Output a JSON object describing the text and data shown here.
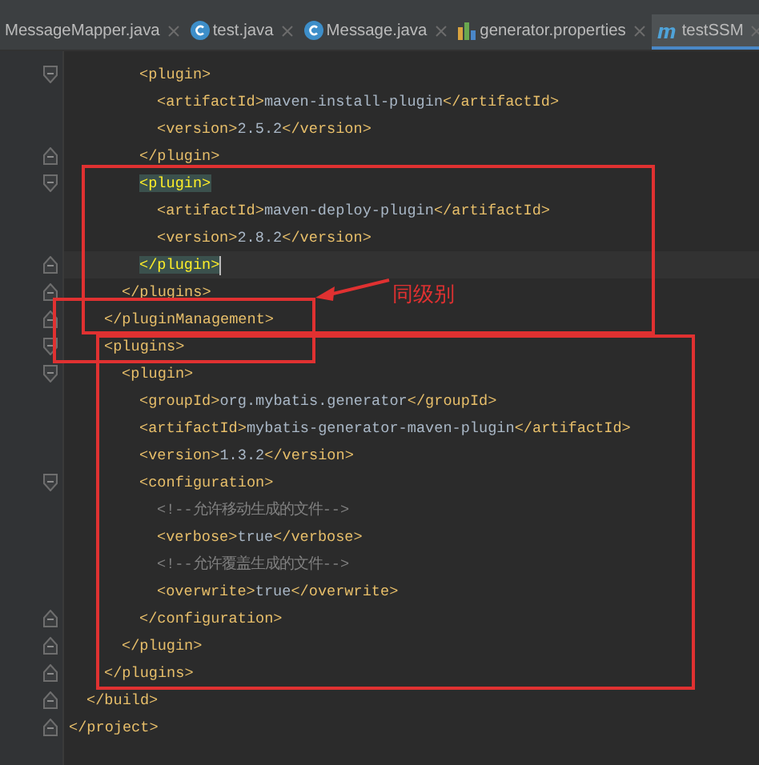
{
  "tabs": [
    {
      "label": "MessageMapper.java",
      "kind": "plain",
      "selected": false
    },
    {
      "label": "test.java",
      "kind": "class",
      "selected": false
    },
    {
      "label": "Message.java",
      "kind": "class",
      "selected": false
    },
    {
      "label": "generator.properties",
      "kind": "properties",
      "selected": false
    },
    {
      "label": "testSSM",
      "kind": "maven",
      "selected": true
    }
  ],
  "lines": [
    {
      "kind": "opener",
      "tokens": [
        {
          "kind": "tag",
          "text": "<plugin>"
        }
      ]
    },
    {
      "kind": "plain",
      "tokens": [
        {
          "kind": "tag",
          "text": "<artifactId>"
        },
        {
          "kind": "text",
          "text": "maven-install-plugin"
        },
        {
          "kind": "tag",
          "text": "</artifactId>"
        }
      ]
    },
    {
      "kind": "plain",
      "tokens": [
        {
          "kind": "tag",
          "text": "<version>"
        },
        {
          "kind": "text",
          "text": "2.5.2"
        },
        {
          "kind": "tag",
          "text": "</version>"
        }
      ]
    },
    {
      "kind": "closer",
      "tokens": [
        {
          "kind": "tag",
          "text": "</plugin>"
        }
      ]
    },
    {
      "kind": "opener",
      "tag_highlight": true,
      "tokens": [
        {
          "kind": "tag",
          "text": "<plugin>"
        }
      ]
    },
    {
      "kind": "plain",
      "tokens": [
        {
          "kind": "tag",
          "text": "<artifactId>"
        },
        {
          "kind": "text",
          "text": "maven-deploy-plugin"
        },
        {
          "kind": "tag",
          "text": "</artifactId>"
        }
      ]
    },
    {
      "kind": "plain",
      "tokens": [
        {
          "kind": "tag",
          "text": "<version>"
        },
        {
          "kind": "text",
          "text": "2.8.2"
        },
        {
          "kind": "tag",
          "text": "</version>"
        }
      ]
    },
    {
      "kind": "closer",
      "tag_highlight": true,
      "current": true,
      "tokens": [
        {
          "kind": "tag",
          "text": "</plugin>"
        }
      ]
    },
    {
      "kind": "closer",
      "tokens": [
        {
          "kind": "tag",
          "text": "</plugins>"
        }
      ]
    },
    {
      "kind": "closer",
      "tokens": [
        {
          "kind": "tag",
          "text": "</pluginManagement>"
        }
      ]
    },
    {
      "kind": "opener",
      "tokens": [
        {
          "kind": "tag",
          "text": "<plugins>"
        }
      ]
    },
    {
      "kind": "opener",
      "tokens": [
        {
          "kind": "tag",
          "text": "<plugin>"
        }
      ]
    },
    {
      "kind": "plain",
      "tokens": [
        {
          "kind": "tag",
          "text": "<groupId>"
        },
        {
          "kind": "text",
          "text": "org.mybatis.generator"
        },
        {
          "kind": "tag",
          "text": "</groupId>"
        }
      ]
    },
    {
      "kind": "plain",
      "tokens": [
        {
          "kind": "tag",
          "text": "<artifactId>"
        },
        {
          "kind": "text",
          "text": "mybatis-generator-maven-plugin"
        },
        {
          "kind": "tag",
          "text": "</artifactId>"
        }
      ]
    },
    {
      "kind": "plain",
      "tokens": [
        {
          "kind": "tag",
          "text": "<version>"
        },
        {
          "kind": "text",
          "text": "1.3.2"
        },
        {
          "kind": "tag",
          "text": "</version>"
        }
      ]
    },
    {
      "kind": "opener",
      "tokens": [
        {
          "kind": "tag",
          "text": "<configuration>"
        }
      ]
    },
    {
      "kind": "plain",
      "tokens": [
        {
          "kind": "comment",
          "text": "<!--允许移动生成的文件-->"
        }
      ]
    },
    {
      "kind": "plain",
      "tokens": [
        {
          "kind": "tag",
          "text": "<verbose>"
        },
        {
          "kind": "text",
          "text": "true"
        },
        {
          "kind": "tag",
          "text": "</verbose>"
        }
      ]
    },
    {
      "kind": "plain",
      "tokens": [
        {
          "kind": "comment",
          "text": "<!--允许覆盖生成的文件-->"
        }
      ]
    },
    {
      "kind": "plain",
      "tokens": [
        {
          "kind": "tag",
          "text": "<overwrite>"
        },
        {
          "kind": "text",
          "text": "true"
        },
        {
          "kind": "tag",
          "text": "</overwrite>"
        }
      ]
    },
    {
      "kind": "closer",
      "tokens": [
        {
          "kind": "tag",
          "text": "</configuration>"
        }
      ]
    },
    {
      "kind": "closer",
      "tokens": [
        {
          "kind": "tag",
          "text": "</plugin>"
        }
      ]
    },
    {
      "kind": "closer",
      "tokens": [
        {
          "kind": "tag",
          "text": "</plugins>"
        }
      ]
    },
    {
      "kind": "closer",
      "tokens": [
        {
          "kind": "tag",
          "text": "</build>"
        }
      ]
    },
    {
      "kind": "closer",
      "tokens": [
        {
          "kind": "tag",
          "text": "</project>"
        }
      ]
    }
  ],
  "annotation": {
    "label": "同级别"
  }
}
